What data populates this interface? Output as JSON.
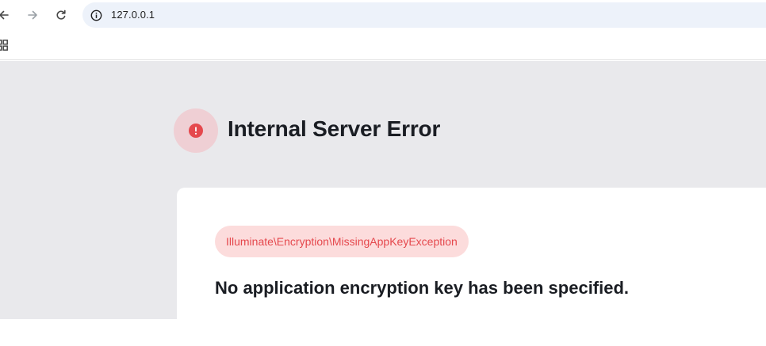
{
  "browser": {
    "url": "127.0.0.1"
  },
  "error": {
    "title": "Internal Server Error",
    "exception_class": "Illuminate\\Encryption\\MissingAppKeyException",
    "message": "No application encryption key has been specified."
  },
  "icons": {
    "back": "arrow-left-icon",
    "forward": "arrow-right-icon",
    "reload": "reload-icon",
    "site_info": "info-icon",
    "apps": "apps-grid-icon",
    "error": "exclamation-icon"
  },
  "colors": {
    "page_background": "#e9e9ec",
    "error_accent": "#e5484d",
    "error_badge_bg": "#efcfd4",
    "pill_bg": "#fcdcdc",
    "omnibox_bg": "#edf2fa"
  }
}
